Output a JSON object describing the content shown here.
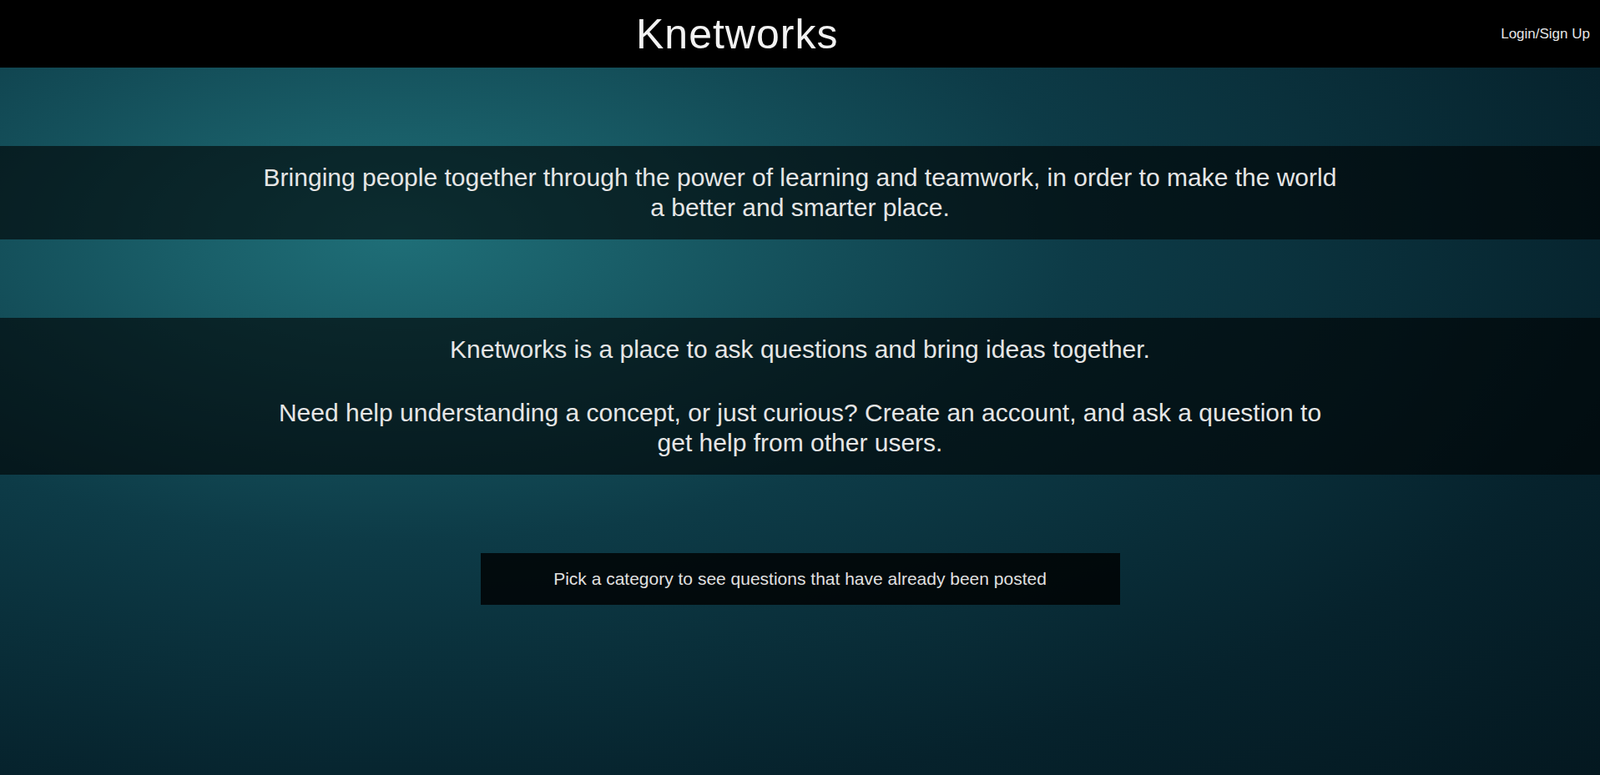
{
  "header": {
    "title": "Knetworks",
    "login": "Login/Sign Up"
  },
  "tagline": "Bringing people together through the power of learning and teamwork, in order to make the world a better and smarter place.",
  "intro": [
    "Knetworks is a place to ask questions and bring ideas together.",
    "Need help understanding a concept, or just curious? Create an account, and ask a question to get help from other users."
  ],
  "category_prompt": "Pick a category to see questions that have already been posted"
}
